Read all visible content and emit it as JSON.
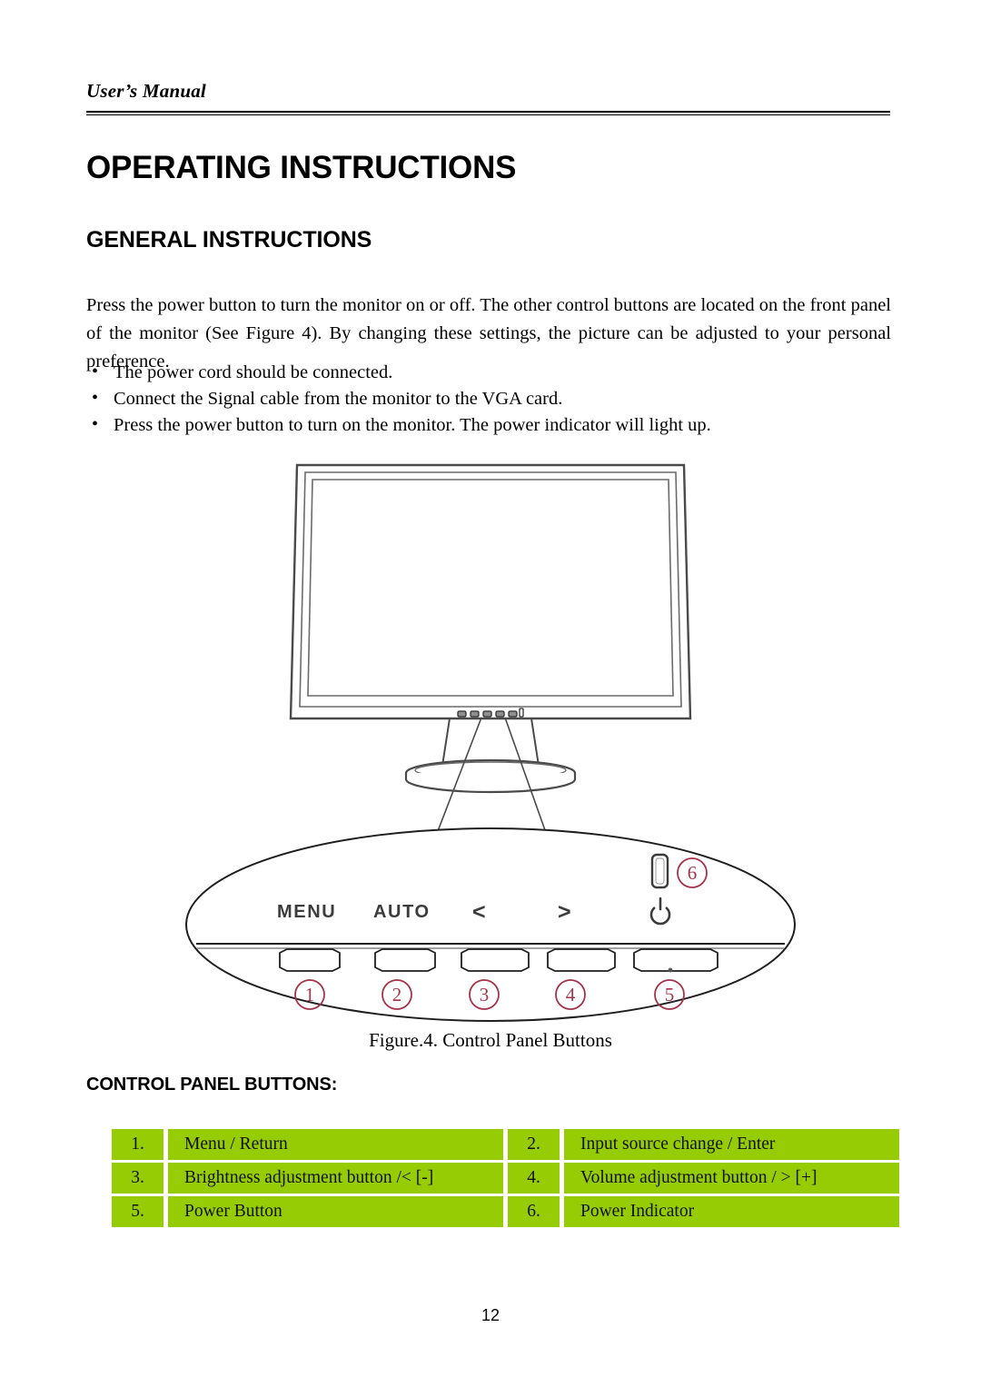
{
  "header": {
    "running_head": "User’s Manual"
  },
  "titles": {
    "document_title": "OPERATING INSTRUCTIONS",
    "section_title": "GENERAL INSTRUCTIONS"
  },
  "body": {
    "paragraph": "Press the power button to turn the monitor on or off. The other control buttons are located on the front panel of the monitor (See Figure 4). By changing these settings, the picture can be adjusted to your personal preference.",
    "bullet_marker": "•",
    "bullets": [
      "The power cord should be connected.",
      "Connect the Signal cable from the monitor to the VGA card.",
      "Press the power button to turn on the monitor. The power indicator will light up."
    ]
  },
  "figure": {
    "caption": "Figure.4. Control Panel Buttons",
    "panel_labels": {
      "menu": "MENU",
      "auto": "AUTO",
      "left": "<",
      "right": ">",
      "power_symbol": "⏻"
    },
    "callouts": [
      "1",
      "2",
      "3",
      "4",
      "5",
      "6"
    ],
    "callout_color": "#A4344B",
    "line_color": "#3A3A3A"
  },
  "table": {
    "heading": "CONTROL PANEL BUTTONS:",
    "cell_color": "#96CC03",
    "rows": [
      {
        "left_num": "1.",
        "left_label": "Menu / Return",
        "right_num": "2.",
        "right_label": "Input source change / Enter"
      },
      {
        "left_num": "3.",
        "left_label": "Brightness adjustment button /< [-]",
        "right_num": "4.",
        "right_label": "Volume adjustment button / > [+]"
      },
      {
        "left_num": "5.",
        "left_label": "Power Button",
        "right_num": "6.",
        "right_label": "Power Indicator"
      }
    ]
  },
  "footer": {
    "page_number": "12"
  }
}
